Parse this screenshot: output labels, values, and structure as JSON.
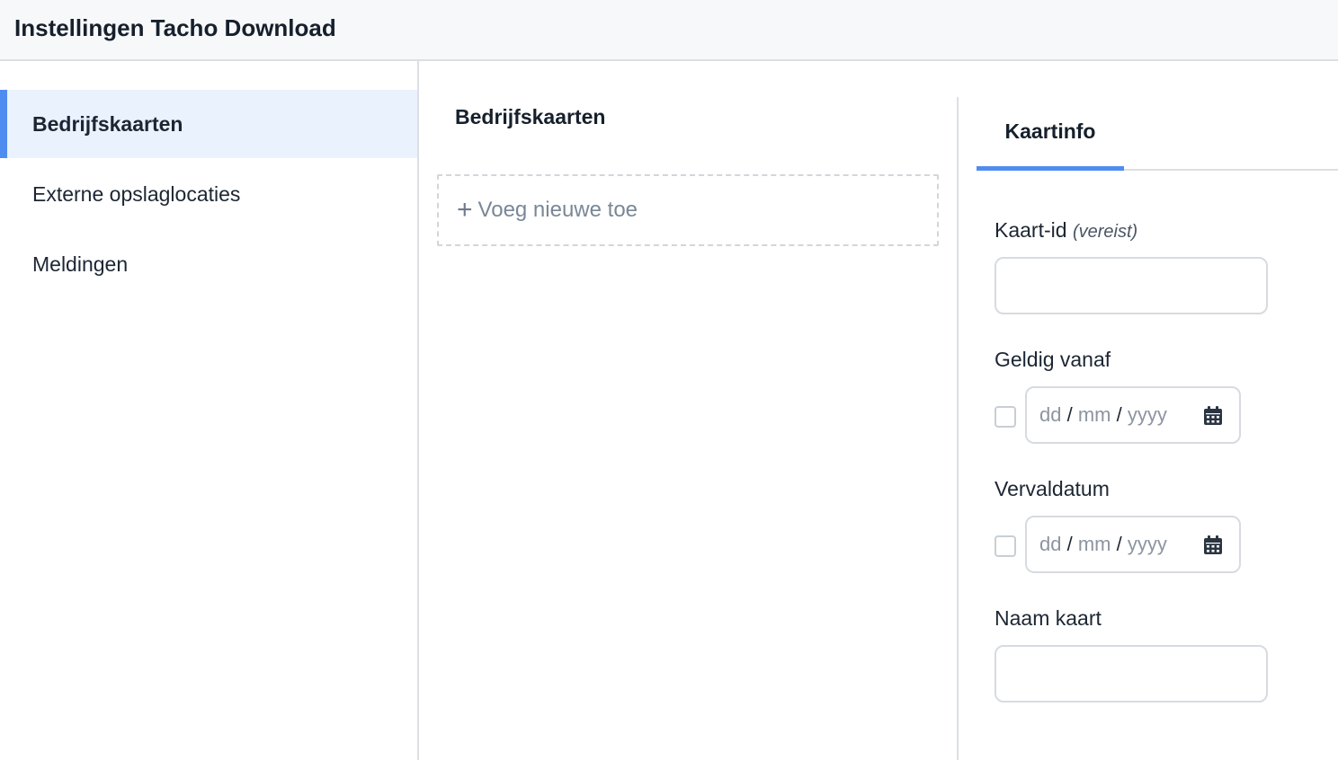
{
  "header": {
    "title": "Instellingen Tacho Download"
  },
  "sidebar": {
    "items": [
      {
        "label": "Bedrijfskaarten",
        "active": true
      },
      {
        "label": "Externe opslaglocaties",
        "active": false
      },
      {
        "label": "Meldingen",
        "active": false
      }
    ]
  },
  "cards_panel": {
    "title": "Bedrijfskaarten",
    "add_label": "Voeg nieuwe toe"
  },
  "card_info": {
    "tab_label": "Kaartinfo",
    "card_id": {
      "label": "Kaart-id",
      "required_note": "(vereist)",
      "value": ""
    },
    "valid_from": {
      "label": "Geldig vanaf",
      "day_placeholder": "dd",
      "month_placeholder": "mm",
      "year_placeholder": "yyyy",
      "separator": "/",
      "checked": false
    },
    "expiry": {
      "label": "Vervaldatum",
      "day_placeholder": "dd",
      "month_placeholder": "mm",
      "year_placeholder": "yyyy",
      "separator": "/",
      "checked": false
    },
    "card_name": {
      "label": "Naam kaart",
      "value": ""
    }
  },
  "colors": {
    "accent": "#4f8cf0",
    "active_bg": "#eaf2fd",
    "header_bg": "#f7f8fa",
    "border": "#dcdfe4"
  },
  "icons": {
    "add": "plus-icon",
    "date": "calendar-icon"
  }
}
